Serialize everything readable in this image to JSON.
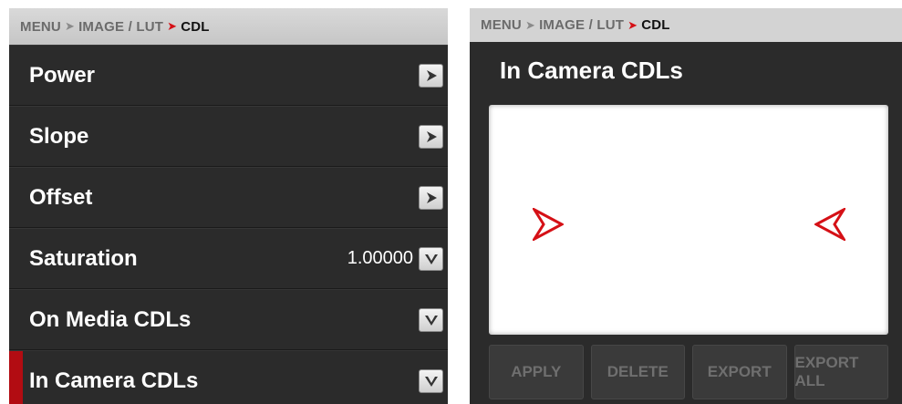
{
  "left_panel": {
    "breadcrumb": {
      "menu": "MENU",
      "image_lut": "IMAGE / LUT",
      "current": "CDL"
    },
    "rows": [
      {
        "label": "Power",
        "value": "",
        "control": "arrow-right-icon"
      },
      {
        "label": "Slope",
        "value": "",
        "control": "arrow-right-icon"
      },
      {
        "label": "Offset",
        "value": "",
        "control": "arrow-right-icon"
      },
      {
        "label": "Saturation",
        "value": "1.00000",
        "control": "chevron-down-icon"
      },
      {
        "label": "On Media CDLs",
        "value": "",
        "control": "chevron-down-icon"
      },
      {
        "label": "In Camera CDLs",
        "value": "",
        "control": "chevron-down-icon",
        "selected": true
      }
    ]
  },
  "right_panel": {
    "breadcrumb": {
      "menu": "MENU",
      "image_lut": "IMAGE / LUT",
      "current": "CDL"
    },
    "title": "In Camera CDLs",
    "buttons": {
      "apply": "APPLY",
      "delete": "DELETE",
      "export": "EXPORT",
      "export_all": "EXPORT ALL"
    }
  },
  "colors": {
    "accent_red": "#d51016",
    "panel_bg": "#2b2b2b",
    "crumb_bg": "#d3d3d3"
  }
}
